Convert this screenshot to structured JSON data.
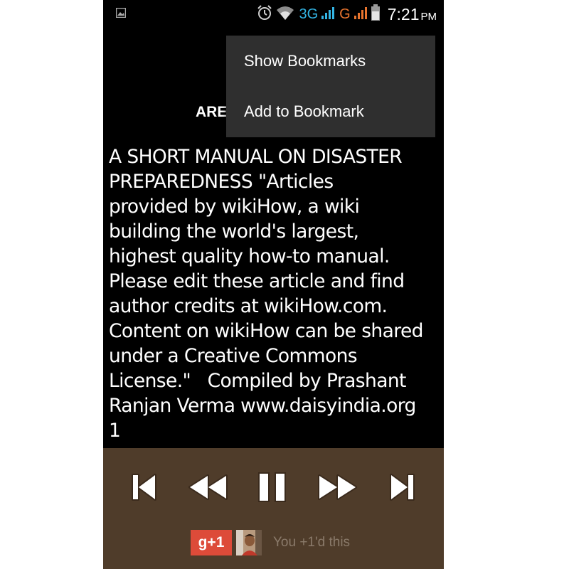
{
  "status_bar": {
    "network_3g": "3G",
    "network_g": "G",
    "time": "7:21",
    "ampm": "PM"
  },
  "menu": {
    "items": [
      {
        "label": "Show Bookmarks"
      },
      {
        "label": "Add to Bookmark"
      }
    ]
  },
  "book": {
    "heading_visible": "ARE",
    "text": "A SHORT MANUAL ON DISASTER\nPREPAREDNESS \"Articles\nprovided by wikiHow, a wiki\nbuilding the world's largest,\nhighest quality how-to manual.\nPlease edit these article and find\nauthor credits at wikiHow.com.\nContent on wikiHow can be shared\nunder a Creative Commons\nLicense.\"   Compiled by Prashant\nRanjan Verma www.daisyindia.org\n1"
  },
  "social": {
    "gplus_label": "g+1",
    "plus_text": "You +1'd this"
  },
  "colors": {
    "player_bg": "#4f3c2a",
    "menu_bg": "#2f2f2f",
    "gplus_red": "#dd4b39",
    "accent_blue": "#33b5e5",
    "accent_orange": "#e8742e"
  }
}
